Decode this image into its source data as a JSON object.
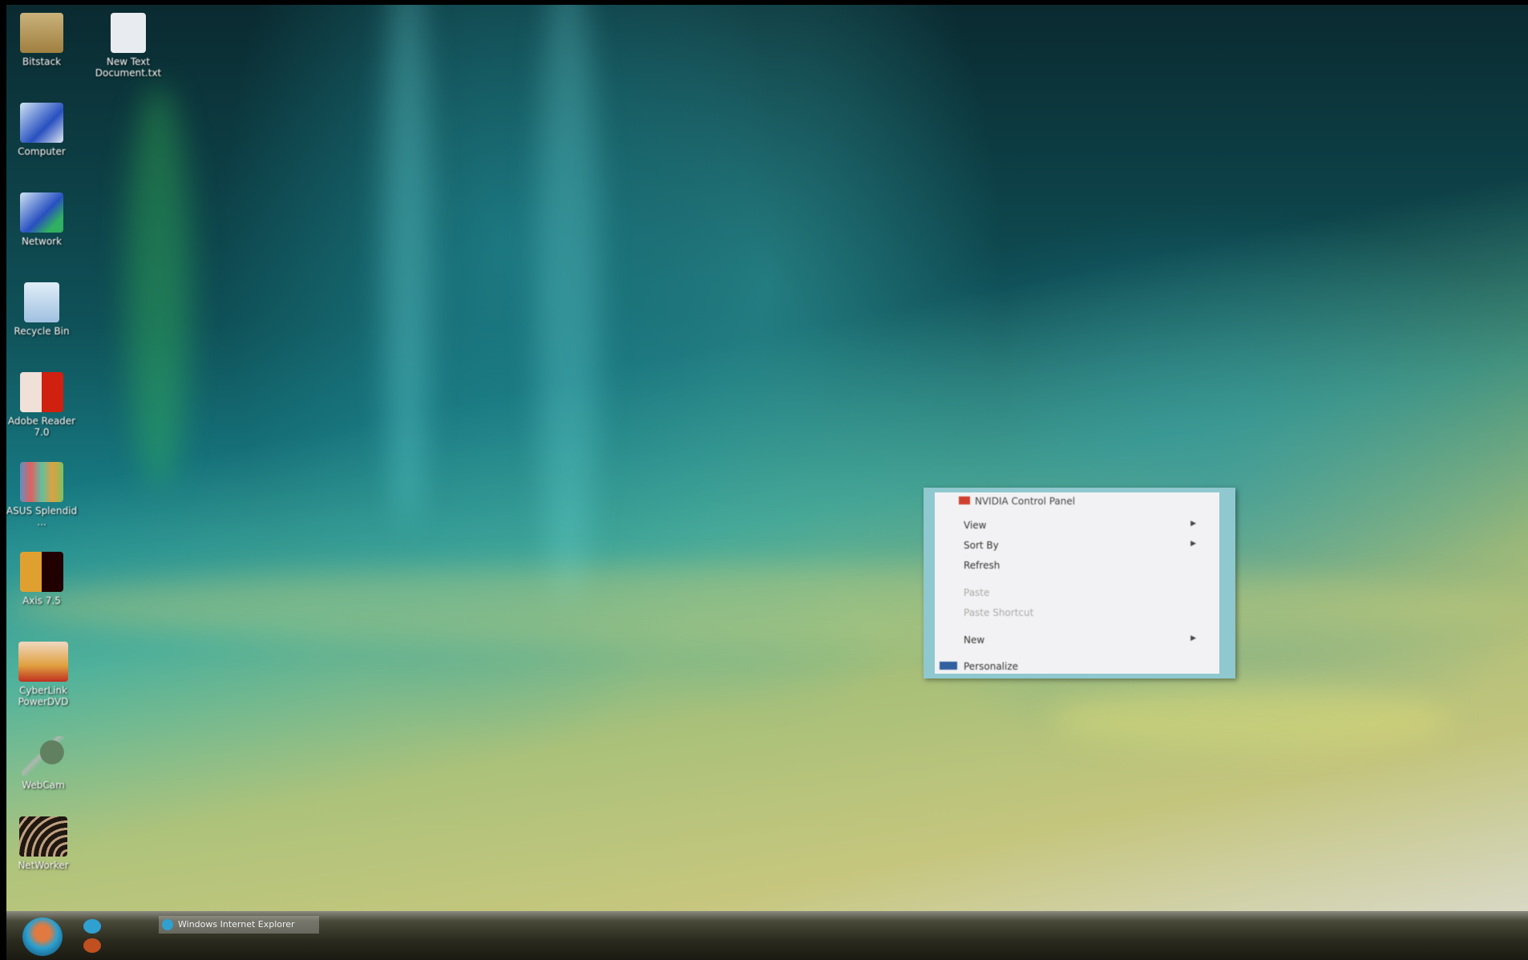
{
  "desktop_icons": [
    {
      "label": "Bitstack",
      "icon": "folder-icon"
    },
    {
      "label": "New Text Document.txt",
      "icon": "text-file-icon"
    },
    {
      "label": "Computer",
      "icon": "computer-icon"
    },
    {
      "label": "Network",
      "icon": "network-icon"
    },
    {
      "label": "Recycle Bin",
      "icon": "recycle-bin-icon"
    },
    {
      "label": "Adobe Reader 7.0",
      "icon": "adobe-reader-icon"
    },
    {
      "label": "ASUS Splendid ...",
      "icon": "asus-splendid-icon"
    },
    {
      "label": "Axis 7.5",
      "icon": "app-icon"
    },
    {
      "label": "CyberLink PowerDVD",
      "icon": "powerdvd-icon"
    },
    {
      "label": "WebCam",
      "icon": "webcam-icon"
    },
    {
      "label": "NetWorker",
      "icon": "app-icon"
    }
  ],
  "context_menu": {
    "items": [
      {
        "label": "NVIDIA Control Panel"
      },
      {
        "label": "View"
      },
      {
        "label": "Sort By"
      },
      {
        "label": "Refresh"
      },
      {
        "label": "Paste"
      },
      {
        "label": "Paste Shortcut"
      },
      {
        "label": "New"
      },
      {
        "label": "Personalize"
      }
    ]
  },
  "taskbar": {
    "task_label": "Windows Internet Explorer"
  }
}
